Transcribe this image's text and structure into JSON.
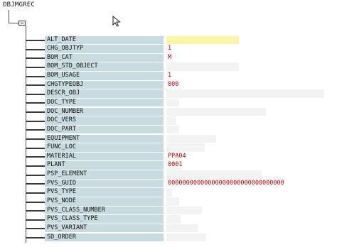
{
  "root": {
    "label": "OBJMGREC"
  },
  "fields": [
    {
      "name": "ALT_DATE",
      "value": "",
      "state": "editing"
    },
    {
      "name": "CHG_OBJTYP",
      "value": "1"
    },
    {
      "name": "BOM_CAT",
      "value": "M"
    },
    {
      "name": "BOM_STD_OBJECT",
      "value": ""
    },
    {
      "name": "BOM_USAGE",
      "value": "1"
    },
    {
      "name": "CHGTYPEOBJ",
      "value": "000"
    },
    {
      "name": "DESCR_OBJ",
      "value": ""
    },
    {
      "name": "DOC_TYPE",
      "value": ""
    },
    {
      "name": "DOC_NUMBER",
      "value": ""
    },
    {
      "name": "DOC_VERS",
      "value": ""
    },
    {
      "name": "DOC_PART",
      "value": ""
    },
    {
      "name": "EQUIPMENT",
      "value": ""
    },
    {
      "name": "FUNC_LOC",
      "value": ""
    },
    {
      "name": "MATERIAL",
      "value": "PPA04"
    },
    {
      "name": "PLANT",
      "value": "0001"
    },
    {
      "name": "PSP_ELEMENT",
      "value": ""
    },
    {
      "name": "PVS_GUID",
      "value": "00000000000000000000000000000000"
    },
    {
      "name": "PVS_TYPE",
      "value": ""
    },
    {
      "name": "PVS_NODE",
      "value": ""
    },
    {
      "name": "PVS_CLASS_NUMBER",
      "value": ""
    },
    {
      "name": "PVS_CLASS_TYPE",
      "value": ""
    },
    {
      "name": "PVS_VARIANT",
      "value": ""
    },
    {
      "name": "SD_ORDER",
      "value": ""
    }
  ],
  "colors": {
    "name_bg": "#c8dbe0",
    "value_text": "#c00000",
    "edit_bg": "#fdf5a6"
  },
  "icons": {
    "root_node": "folder-expanded-icon",
    "pointer": "mouse-cursor-icon"
  }
}
